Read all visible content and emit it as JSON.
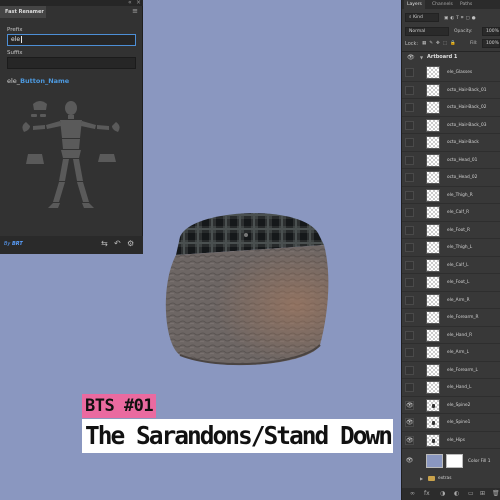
{
  "fast_renamer": {
    "title": "Fast Renamer",
    "prefix_label": "Prefix",
    "prefix_value": "ele",
    "suffix_label": "Suffix",
    "suffix_value": "",
    "result_prefix": "ele_",
    "result_name": "Button_Name",
    "by_label": "By",
    "brand": "BRT"
  },
  "overlay": {
    "tag": "BTS #01",
    "title": "The Sarandons/Stand Down"
  },
  "layers_panel": {
    "tabs": [
      "Layers",
      "Channels",
      "Paths"
    ],
    "filter_value": "Kind",
    "blend_mode": "Normal",
    "opacity_label": "Opacity:",
    "opacity_value": "100%",
    "lock_label": "Lock:",
    "fill_label": "Fill:",
    "fill_value": "100%",
    "artboard_name": "Artboard 1",
    "layers": [
      {
        "name": "ele_Glasses",
        "visible": false
      },
      {
        "name": "octo_Hair-Back_01",
        "visible": false
      },
      {
        "name": "octo_Hair-Back_02",
        "visible": false
      },
      {
        "name": "octo_Hair-Back_03",
        "visible": false
      },
      {
        "name": "octo_Hair-Back",
        "visible": false
      },
      {
        "name": "octo_Head_01",
        "visible": false
      },
      {
        "name": "octo_Head_02",
        "visible": false
      },
      {
        "name": "ele_Thigh_R",
        "visible": false
      },
      {
        "name": "ele_Calf_R",
        "visible": false
      },
      {
        "name": "ele_Foot_R",
        "visible": false
      },
      {
        "name": "ele_Thigh_L",
        "visible": false
      },
      {
        "name": "ele_Calf_L",
        "visible": false
      },
      {
        "name": "ele_Foot_L",
        "visible": false
      },
      {
        "name": "ele_Arm_R",
        "visible": false
      },
      {
        "name": "ele_Forearm_R",
        "visible": false
      },
      {
        "name": "ele_Hand_R",
        "visible": false
      },
      {
        "name": "ele_Arm_L",
        "visible": false
      },
      {
        "name": "ele_Forearm_L",
        "visible": false
      },
      {
        "name": "ele_Hand_L",
        "visible": false
      },
      {
        "name": "ele_Spine2",
        "visible": true
      },
      {
        "name": "ele_Spine1",
        "visible": true
      },
      {
        "name": "ele_Hips",
        "visible": true
      }
    ],
    "fill_layer_name": "Color Fill 1",
    "folder_name": "extras"
  }
}
